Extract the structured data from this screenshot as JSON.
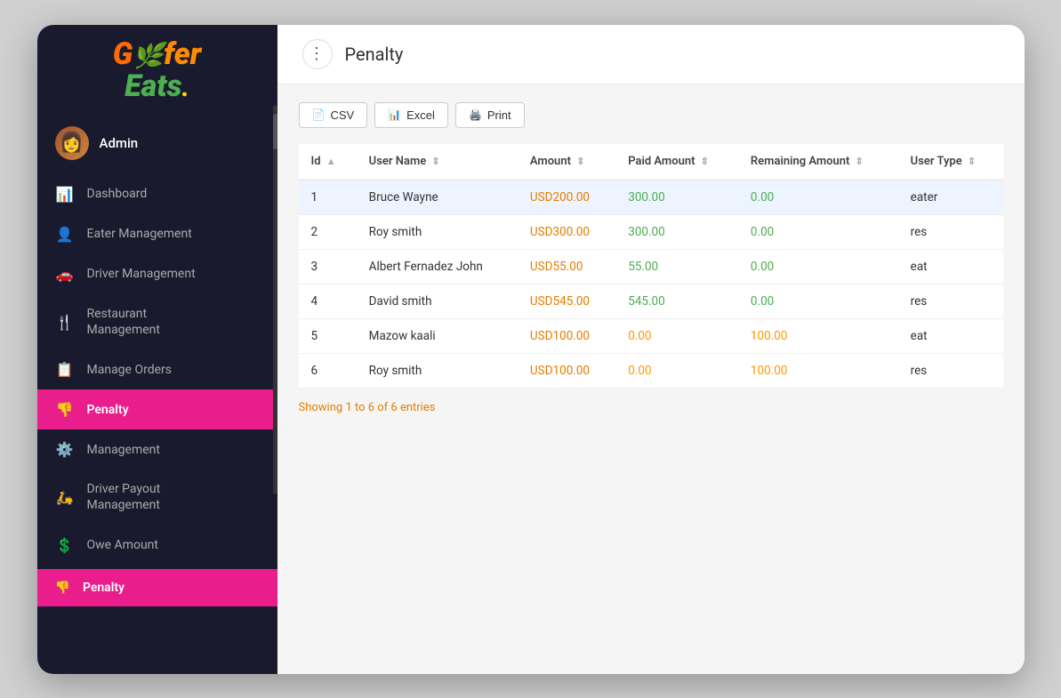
{
  "app": {
    "title": "Penalty",
    "logo_line1": "G fer",
    "logo_line2": "Eats.",
    "colors": {
      "sidebar_bg": "#1a1a2e",
      "active_pink": "#e91e8c",
      "amount_orange": "#e67e00",
      "paid_green": "#4caf50",
      "remaining_orange": "#ff9800",
      "link_blue": "#2196f3"
    }
  },
  "admin": {
    "name": "Admin",
    "avatar_emoji": "👩"
  },
  "nav": {
    "items": [
      {
        "id": "dashboard",
        "icon": "📊",
        "label": "Dashboard",
        "active": false
      },
      {
        "id": "eater-management",
        "icon": "👤",
        "label": "Eater Management",
        "active": false
      },
      {
        "id": "driver-management",
        "icon": "🚗",
        "label": "Driver Management",
        "active": false
      },
      {
        "id": "restaurant-management",
        "icon": "🍴",
        "label": "Restaurant\nManagement",
        "active": false
      },
      {
        "id": "manage-orders",
        "icon": "📋",
        "label": "Manage Orders",
        "active": false
      },
      {
        "id": "management",
        "icon": "⚙️",
        "label": "Management",
        "active": false
      },
      {
        "id": "driver-payout-management",
        "icon": "🛵",
        "label": "Driver Payout\nManagement",
        "active": false
      },
      {
        "id": "owe-amount",
        "icon": "💲",
        "label": "Owe Amount",
        "active": false
      },
      {
        "id": "penalty",
        "icon": "👎",
        "label": "Penalty",
        "active": true
      }
    ]
  },
  "toolbar": {
    "menu_dots": "⋮",
    "csv_label": "CSV",
    "excel_label": "Excel",
    "print_label": "Print"
  },
  "table": {
    "columns": [
      {
        "id": "id",
        "label": "Id",
        "sortable": true
      },
      {
        "id": "user_name",
        "label": "User Name",
        "sortable": true
      },
      {
        "id": "amount",
        "label": "Amount",
        "sortable": true
      },
      {
        "id": "paid_amount",
        "label": "Paid Amount",
        "sortable": true
      },
      {
        "id": "remaining_amount",
        "label": "Remaining Amount",
        "sortable": true
      },
      {
        "id": "user_type",
        "label": "User Type",
        "sortable": true
      }
    ],
    "rows": [
      {
        "id": 1,
        "user_name": "Bruce Wayne",
        "amount": "USD200.00",
        "paid_amount": "300.00",
        "remaining_amount": "0.00",
        "user_type": "eater"
      },
      {
        "id": 2,
        "user_name": "Roy smith",
        "amount": "USD300.00",
        "paid_amount": "300.00",
        "remaining_amount": "0.00",
        "user_type": "res"
      },
      {
        "id": 3,
        "user_name": "Albert Fernadez John",
        "amount": "USD55.00",
        "paid_amount": "55.00",
        "remaining_amount": "0.00",
        "user_type": "eat"
      },
      {
        "id": 4,
        "user_name": "David smith",
        "amount": "USD545.00",
        "paid_amount": "545.00",
        "remaining_amount": "0.00",
        "user_type": "res"
      },
      {
        "id": 5,
        "user_name": "Mazow kaali",
        "amount": "USD100.00",
        "paid_amount": "0.00",
        "remaining_amount": "100.00",
        "user_type": "eat"
      },
      {
        "id": 6,
        "user_name": "Roy smith",
        "amount": "USD100.00",
        "paid_amount": "0.00",
        "remaining_amount": "100.00",
        "user_type": "res"
      }
    ],
    "footer_text": "Showing ",
    "footer_range": "1 to 6 of 6",
    "footer_suffix": " entries"
  }
}
